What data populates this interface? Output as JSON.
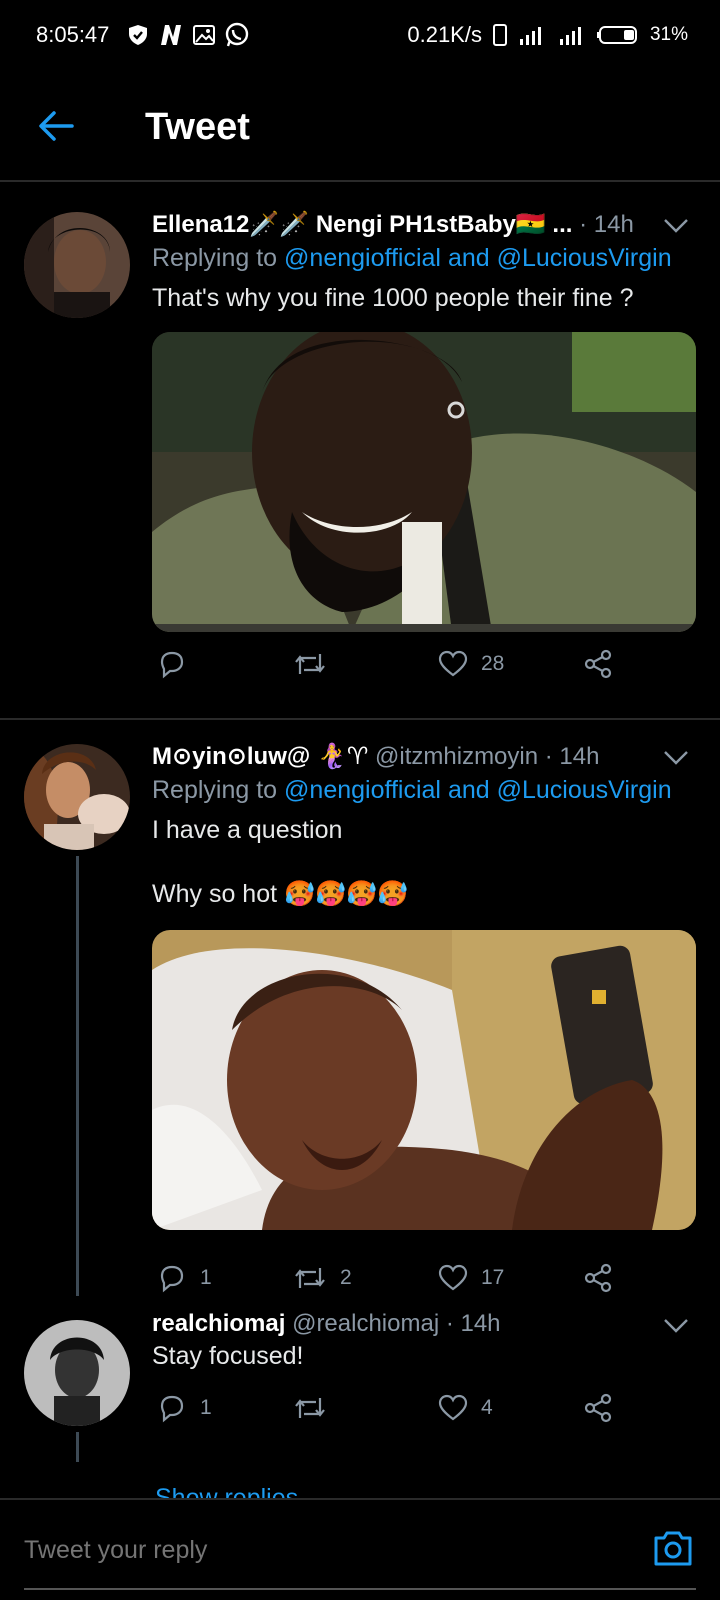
{
  "status_bar": {
    "time": "8:05:47",
    "net_speed": "0.21K/s",
    "battery": "31%"
  },
  "header": {
    "title": "Tweet"
  },
  "colors": {
    "accent": "#1d9bf0",
    "background": "#000000",
    "muted": "#8b98a5"
  },
  "tweets": [
    {
      "name": "Ellena12🗡️🗡️ Nengi PH1stBaby🇬🇭 ...",
      "handle": "",
      "dot": " · ",
      "time": "14h",
      "replying_prefix": "Replying to ",
      "mention1": "@nengiofficial",
      "and": " and ",
      "mention2": "@LuciousVirgin",
      "text": "That's why you fine 1000 people their fine ?",
      "media": "photo",
      "replies": "",
      "retweets": "",
      "likes": "28"
    },
    {
      "name": "M⊙yin⊙luw@ 🧜‍♀️♈",
      "handle": " @itzmhizmoyin",
      "dot": " · ",
      "time": "14h",
      "replying_prefix": "Replying to ",
      "mention1": "@nengiofficial",
      "and": " and ",
      "mention2": "@LuciousVirgin",
      "text": "I have a question\n\nWhy so hot 🥵🥵🥵🥵",
      "media": "photo",
      "replies": "1",
      "retweets": "2",
      "likes": "17"
    },
    {
      "name": "realchiomaj",
      "handle": " @realchiomaj",
      "dot": " · ",
      "time": "14h",
      "text": "Stay focused!",
      "replies": "1",
      "retweets": "",
      "likes": "4"
    }
  ],
  "show_replies": "Show replies",
  "reply_bar": {
    "placeholder": "Tweet your reply"
  }
}
